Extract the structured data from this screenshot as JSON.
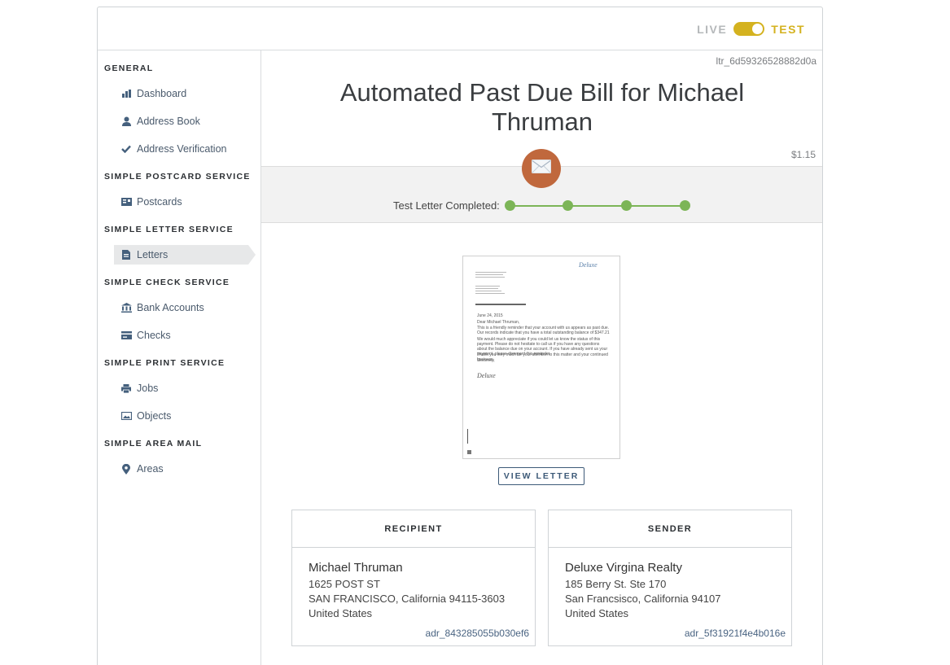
{
  "mode": {
    "live_label": "LIVE",
    "test_label": "TEST",
    "accent": "#d4b21f"
  },
  "sidebar": {
    "sections": [
      {
        "title": "GENERAL",
        "items": [
          {
            "label": "Dashboard",
            "icon": "bar-chart-icon"
          },
          {
            "label": "Address Book",
            "icon": "user-icon"
          },
          {
            "label": "Address Verification",
            "icon": "checkmark-icon"
          }
        ]
      },
      {
        "title": "SIMPLE POSTCARD SERVICE",
        "items": [
          {
            "label": "Postcards",
            "icon": "postcard-icon"
          }
        ]
      },
      {
        "title": "SIMPLE LETTER SERVICE",
        "items": [
          {
            "label": "Letters",
            "icon": "document-icon",
            "active": true
          }
        ]
      },
      {
        "title": "SIMPLE CHECK SERVICE",
        "items": [
          {
            "label": "Bank Accounts",
            "icon": "bank-icon"
          },
          {
            "label": "Checks",
            "icon": "check-card-icon"
          }
        ]
      },
      {
        "title": "SIMPLE PRINT SERVICE",
        "items": [
          {
            "label": "Jobs",
            "icon": "printer-icon"
          },
          {
            "label": "Objects",
            "icon": "image-icon"
          }
        ]
      },
      {
        "title": "SIMPLE AREA MAIL",
        "items": [
          {
            "label": "Areas",
            "icon": "map-pin-icon"
          }
        ]
      }
    ]
  },
  "letter": {
    "id": "ltr_6d59326528882d0a",
    "title": "Automated Past Due Bill for Michael Thruman",
    "price": "$1.15",
    "status_label": "Test Letter Completed:",
    "status_steps": 4,
    "status_color": "#7cb557",
    "envelope_color": "#c0683d",
    "view_button": "VIEW LETTER",
    "preview": {
      "date": "June 24, 2015",
      "greeting": "Dear Michael Thruman,",
      "para1": "This is a friendly reminder that your account with us appears as past due. Our records indicate that you have a total outstanding balance of $347.21",
      "para2": "We would much appreciate if you could let us know the status of this payment. Please do not hesitate to call us if you have any questions about the balance due on your account. If you have already sent us your payment, please disregard this reminder.",
      "thanks": "Thank you very much for your attention to this matter and your continued business.",
      "closing": "Sincerely,",
      "signature": "Deluxe",
      "logo": "Deluxe"
    }
  },
  "recipient": {
    "heading": "RECIPIENT",
    "name": "Michael Thruman",
    "line1": "1625 POST ST",
    "line2": "SAN FRANCISCO, California 94115-3603",
    "country": "United States",
    "adr_id": "adr_843285055b030ef6"
  },
  "sender": {
    "heading": "SENDER",
    "name": "Deluxe Virgina Realty",
    "line1": "185 Berry St. Ste 170",
    "line2": "San Francsisco, California 94107",
    "country": "United States",
    "adr_id": "adr_5f31921f4e4b016e"
  }
}
